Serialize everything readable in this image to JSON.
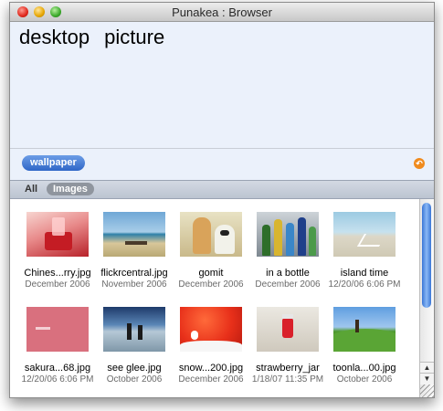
{
  "window": {
    "title": "Punakea : Browser"
  },
  "query": {
    "text": "desktop  picture"
  },
  "tags": [
    {
      "label": "wallpaper"
    }
  ],
  "tagbar": {
    "undo_icon": "undo-arrow-icon",
    "accent": "#f08b1e"
  },
  "filter": {
    "all_label": "All",
    "active_label": "Images"
  },
  "items": [
    {
      "name": "Chines...rry.jpg",
      "date": "December 2006"
    },
    {
      "name": "flickrcentral.jpg",
      "date": "November 2006"
    },
    {
      "name": "gomit",
      "date": "December 2006"
    },
    {
      "name": "in a bottle",
      "date": "December 2006"
    },
    {
      "name": "island time",
      "date": "12/20/06 6:06 PM"
    },
    {
      "name": "sakura...68.jpg",
      "date": "12/20/06 6:06 PM"
    },
    {
      "name": "see glee.jpg",
      "date": "October 2006"
    },
    {
      "name": "snow...200.jpg",
      "date": "December 2006"
    },
    {
      "name": "strawberry_jar",
      "date": "1/18/07 11:35 PM"
    },
    {
      "name": "toonla...00.jpg",
      "date": "October 2006"
    }
  ],
  "colors": {
    "query_bg": "#ebf1fb",
    "tag_pill": "#3a72d2",
    "scroll_thumb": "#3a76d6"
  }
}
